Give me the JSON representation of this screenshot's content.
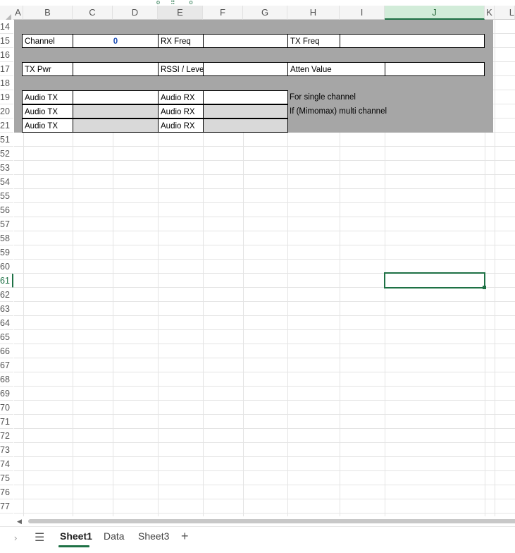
{
  "columns": [
    "A",
    "B",
    "C",
    "D",
    "E",
    "F",
    "G",
    "H",
    "I",
    "J",
    "K",
    "L"
  ],
  "selected_column": "J",
  "rows": [
    "14",
    "15",
    "16",
    "17",
    "18",
    "19",
    "20",
    "21",
    "51",
    "52",
    "53",
    "54",
    "55",
    "56",
    "57",
    "58",
    "59",
    "60",
    "61",
    "62",
    "63",
    "64",
    "65",
    "66",
    "67",
    "68",
    "69",
    "70",
    "71",
    "72",
    "73",
    "74",
    "75",
    "76",
    "77"
  ],
  "selected_row": "61",
  "cells": {
    "channel_label": "Channel",
    "channel_value": "0",
    "rx_freq_label": "RX Freq",
    "tx_freq_label": "TX Freq",
    "tx_pwr_label": "TX Pwr",
    "rssi_label": "RSSI / Level",
    "atten_label": "Atten Value",
    "audio_tx_1": "Audio TX",
    "audio_tx_2": "Audio TX",
    "audio_tx_3": "Audio TX",
    "audio_rx_1": "Audio RX",
    "audio_rx_2": "Audio RX",
    "audio_rx_3": "Audio RX",
    "note_single": "For single channel",
    "note_multi": "If (Mimomax) multi channel"
  },
  "sheet_tabs": [
    "Sheet1",
    "Data",
    "Sheet3"
  ],
  "active_tab": "Sheet1",
  "add_sheet_label": "+",
  "colors": {
    "accent": "#1e7145",
    "block_gray": "#a6a6a6",
    "light_gray": "#d9d9d9",
    "value_blue": "#1f4fb5"
  },
  "icons": {
    "all_sheets": "hamburger-menu-icon",
    "scroll_tabs": "chevron-right-icon"
  }
}
